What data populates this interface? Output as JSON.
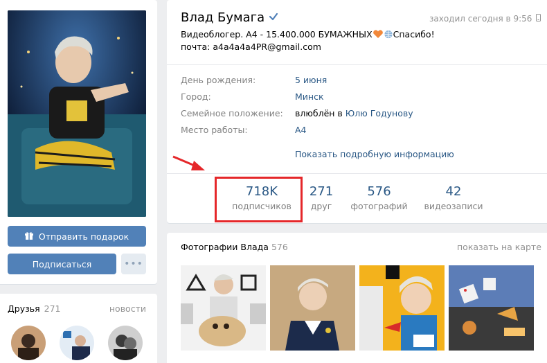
{
  "profile": {
    "name": "Влад Бумага",
    "last_seen": "заходил сегодня в 9:56",
    "bio_line1": "Видеоблогер. А4 - 15.400.000 БУМАЖНЫХ",
    "bio_line1_end": "Спасибо!",
    "bio_line2": "почта: a4a4a4a4PR@gmail.com"
  },
  "info": {
    "birthday_label": "День рождения:",
    "birthday_value": "5 июня",
    "city_label": "Город:",
    "city_value": "Минск",
    "family_label": "Семейное положение:",
    "family_value_prefix": "влюблён в",
    "family_value_link": "Юлю Годунову",
    "work_label": "Место работы:",
    "work_value": "А4",
    "show_more": "Показать подробную информацию"
  },
  "counters": [
    {
      "num": "718K",
      "label": "подписчиков"
    },
    {
      "num": "271",
      "label": "друг"
    },
    {
      "num": "576",
      "label": "фотографий"
    },
    {
      "num": "42",
      "label": "видеозаписи"
    }
  ],
  "actions": {
    "gift": "Отправить подарок",
    "subscribe": "Подписаться",
    "more": "•••"
  },
  "friends": {
    "title": "Друзья",
    "count": "271",
    "news": "новости"
  },
  "photos": {
    "title": "Фотографии Влада",
    "count": "576",
    "map_link": "показать на карте"
  },
  "colors": {
    "accent": "#5181b8",
    "link": "#2a5885",
    "highlight": "#e5272a"
  },
  "icons": [
    "verified-icon",
    "mobile-icon",
    "gift-icon",
    "heart-icon",
    "globe-icon",
    "arrow-icon"
  ]
}
